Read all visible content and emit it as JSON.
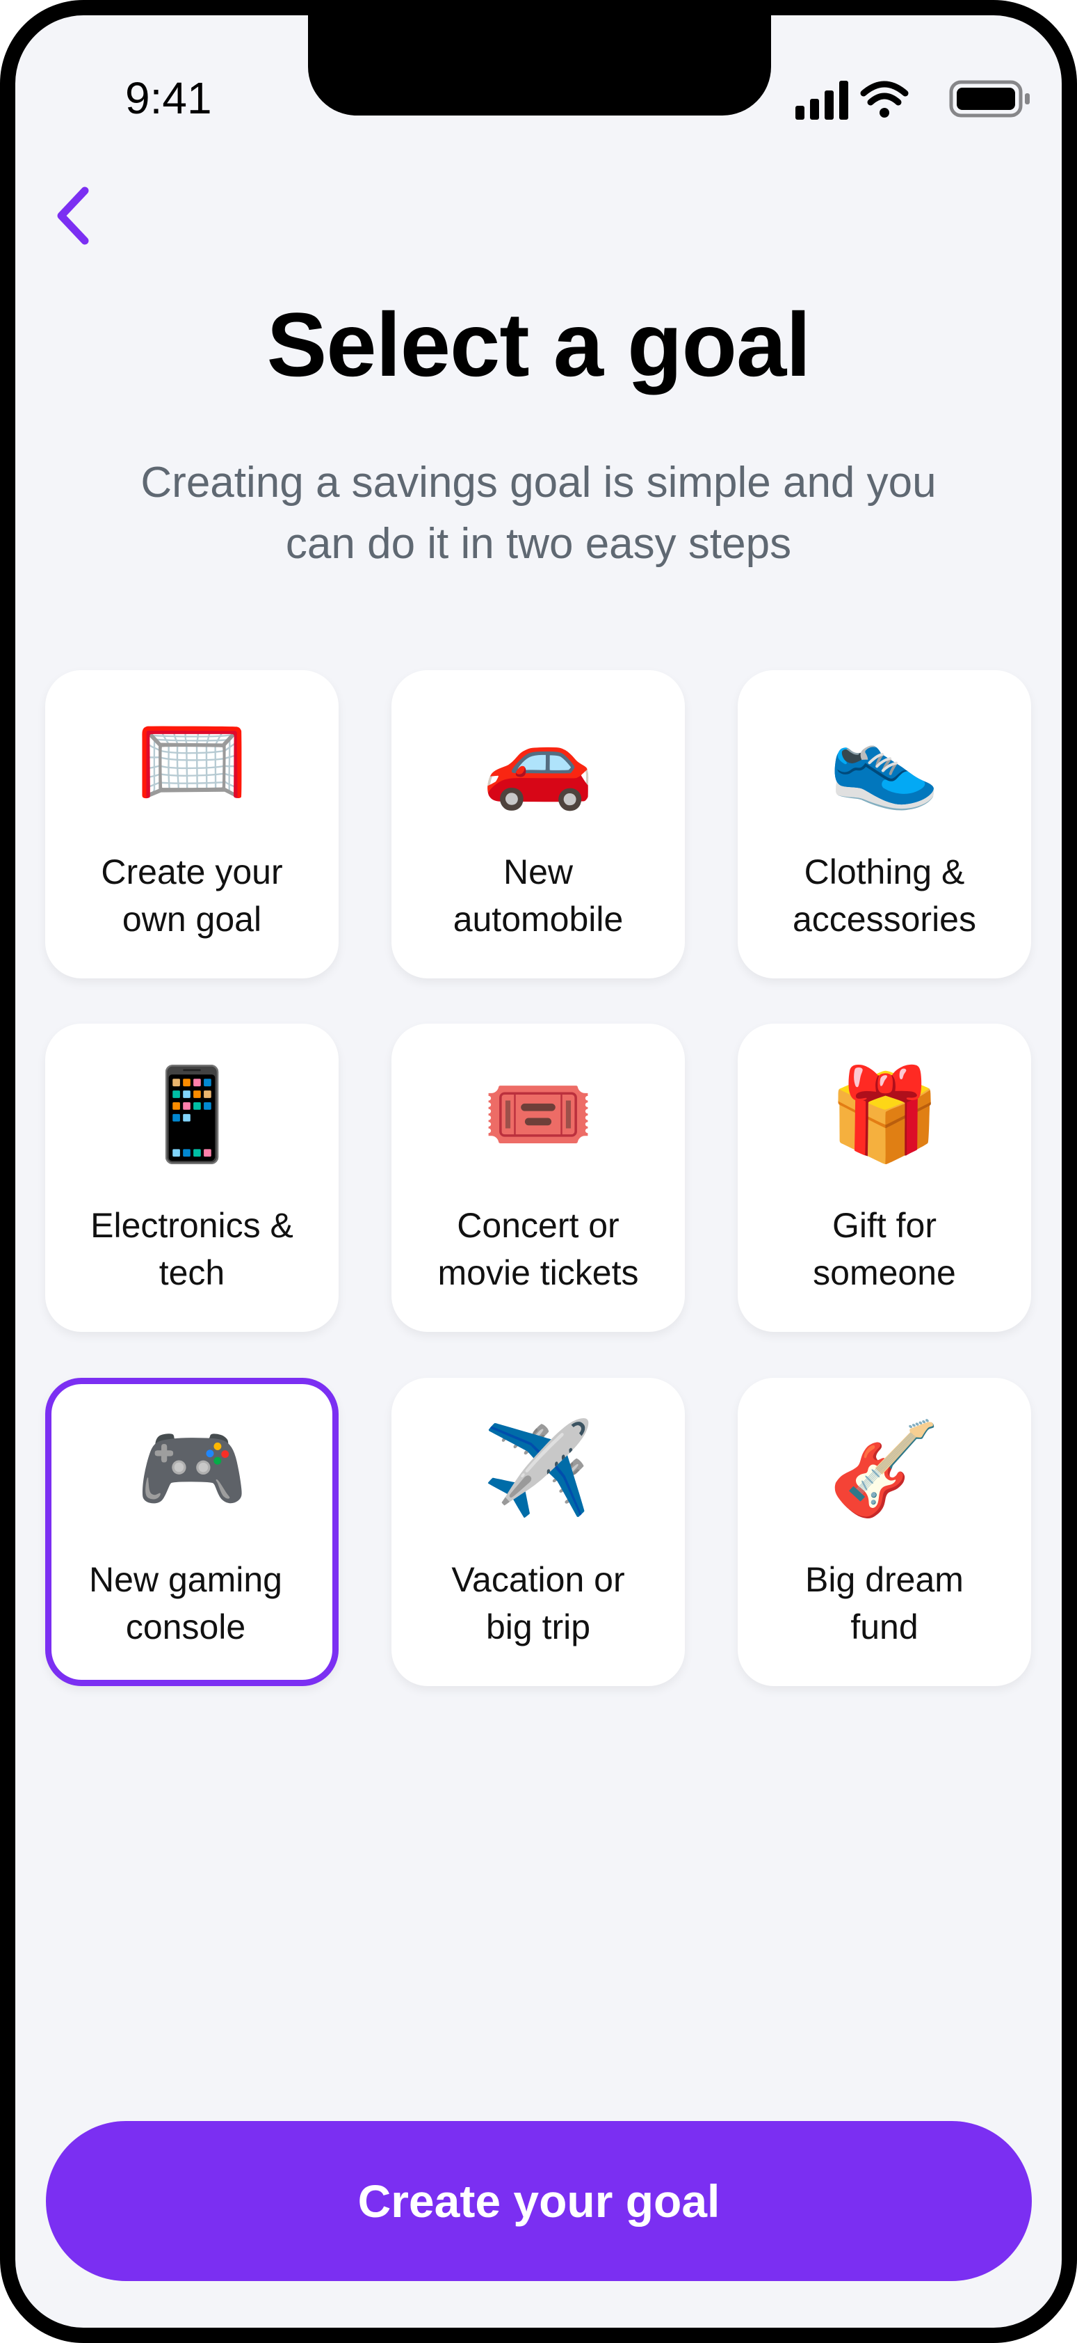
{
  "status_bar": {
    "time": "9:41",
    "icons": [
      "signal-icon",
      "wifi-icon",
      "battery-icon"
    ]
  },
  "nav": {
    "back_icon": "chevron-left-icon"
  },
  "header": {
    "title": "Select a goal",
    "subtitle": "Creating a savings goal is simple and you can do it in two easy steps"
  },
  "goals": [
    {
      "emoji": "🥅",
      "icon": "goal-net-icon",
      "label": "Create your\nown goal",
      "selected": false
    },
    {
      "emoji": "🚗",
      "icon": "car-icon",
      "label": "New\nautomobile",
      "selected": false
    },
    {
      "emoji": "👟",
      "icon": "sneaker-icon",
      "label": "Clothing &\naccessories",
      "selected": false
    },
    {
      "emoji": "📱",
      "icon": "phone-icon",
      "label": "Electronics &\ntech",
      "selected": false
    },
    {
      "emoji": "🎟️",
      "icon": "ticket-icon",
      "label": "Concert or\nmovie tickets",
      "selected": false
    },
    {
      "emoji": "🎁",
      "icon": "gift-icon",
      "label": "Gift for\nsomeone",
      "selected": false
    },
    {
      "emoji": "🎮",
      "icon": "gamepad-icon",
      "label": "New gaming\nconsole",
      "selected": true
    },
    {
      "emoji": "✈️",
      "icon": "airplane-icon",
      "label": "Vacation or\nbig trip",
      "selected": false
    },
    {
      "emoji": "🎸",
      "icon": "guitar-icon",
      "label": "Big dream\nfund",
      "selected": false
    }
  ],
  "cta": {
    "label": "Create your goal"
  },
  "colors": {
    "accent": "#7b2ff2",
    "background": "#f4f5f9",
    "card": "#ffffff",
    "subtitle": "#5f6872"
  }
}
